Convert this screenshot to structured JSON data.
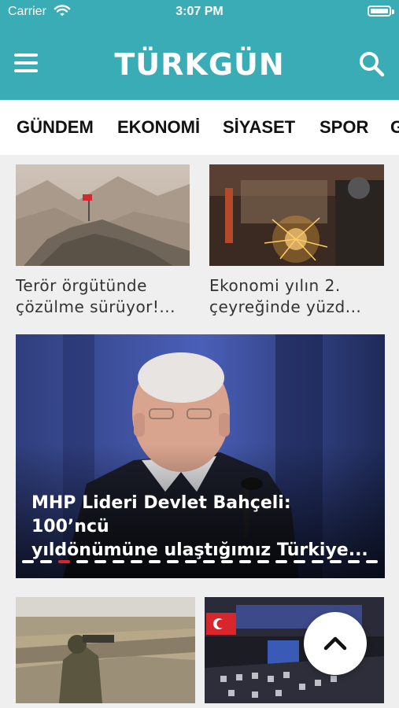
{
  "status_bar": {
    "carrier": "Carrier",
    "time": "3:07 PM"
  },
  "header": {
    "logo": "TÜRKGÜN",
    "menu_icon": "hamburger-menu-icon",
    "search_icon": "search-icon"
  },
  "tabs": [
    "GÜNDEM",
    "EKONOMİ",
    "SİYASET",
    "SPOR",
    "G"
  ],
  "cards": [
    {
      "title_line1": "Terör örgütünde",
      "title_line2": "çözülme sürüyor!..."
    },
    {
      "title_line1": "Ekonomi yılın 2.",
      "title_line2": "çeyreğinde yüzd..."
    }
  ],
  "hero": {
    "title_line1": "MHP Lideri Devlet Bahçeli: 100’ncü",
    "title_line2": "yıldönümüne ulaştığımız Türkiye...",
    "slide_count": 20,
    "active_slide": 3
  },
  "colors": {
    "brand": "#3aacb6",
    "active_dot": "#d8262d"
  },
  "scroll_top_icon": "chevron-up-icon"
}
